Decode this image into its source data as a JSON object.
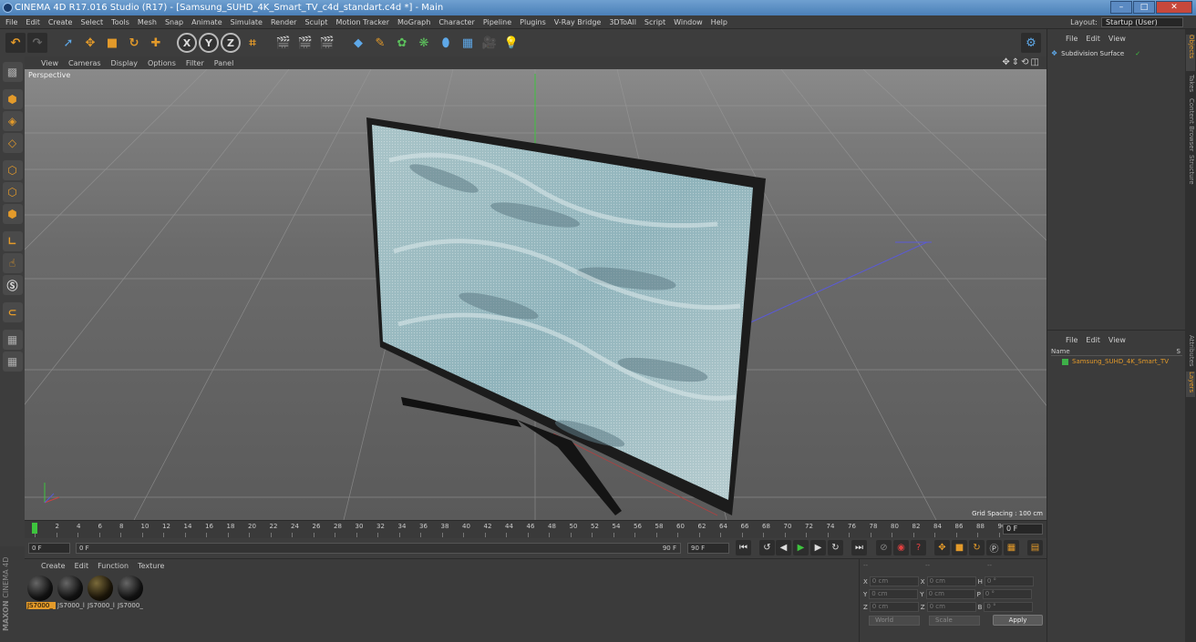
{
  "window": {
    "title": "CINEMA 4D R17.016 Studio (R17) - [Samsung_SUHD_4K_Smart_TV_c4d_standart.c4d *] - Main"
  },
  "menubar": {
    "items": [
      "File",
      "Edit",
      "Create",
      "Select",
      "Tools",
      "Mesh",
      "Snap",
      "Animate",
      "Simulate",
      "Render",
      "Sculpt",
      "Motion Tracker",
      "MoGraph",
      "Character",
      "Pipeline",
      "Plugins",
      "V-Ray Bridge",
      "3DToAll",
      "Script",
      "Window",
      "Help"
    ],
    "layout_label": "Layout:",
    "layout_value": "Startup (User)"
  },
  "toolbar": {
    "axis_x": "X",
    "axis_y": "Y",
    "axis_z": "Z"
  },
  "viewport": {
    "menu": [
      "View",
      "Cameras",
      "Display",
      "Options",
      "Filter",
      "Panel"
    ],
    "label": "Perspective",
    "grid_spacing": "Grid Spacing : 100 cm",
    "icons": "✥⇕⟲◫"
  },
  "timeline": {
    "ticks": [
      "0",
      "2",
      "4",
      "6",
      "8",
      "10",
      "12",
      "14",
      "16",
      "18",
      "20",
      "22",
      "24",
      "26",
      "28",
      "30",
      "32",
      "34",
      "36",
      "38",
      "40",
      "42",
      "44",
      "46",
      "48",
      "50",
      "52",
      "54",
      "56",
      "58",
      "60",
      "62",
      "64",
      "66",
      "68",
      "70",
      "72",
      "74",
      "76",
      "78",
      "80",
      "82",
      "84",
      "86",
      "88",
      "90"
    ],
    "current_frame": "0 F"
  },
  "playbar": {
    "start": "0 F",
    "slider_start": "0 F",
    "slider_end": "90 F",
    "end": "90 F"
  },
  "materials": {
    "menu": [
      "Create",
      "Edit",
      "Function",
      "Texture"
    ],
    "items": [
      "JS7000_",
      "JS7000_l",
      "JS7000_l",
      "JS7000_"
    ],
    "brand_a": "MAXON",
    "brand_b": "CINEMA 4D"
  },
  "coordinates": {
    "header_a": "--",
    "header_b": "--",
    "header_c": "--",
    "rows": [
      {
        "a": "X",
        "av": "0 cm",
        "b": "X",
        "bv": "0 cm",
        "c": "H",
        "cv": "0 °"
      },
      {
        "a": "Y",
        "av": "0 cm",
        "b": "Y",
        "bv": "0 cm",
        "c": "P",
        "cv": "0 °"
      },
      {
        "a": "Z",
        "av": "0 cm",
        "b": "Z",
        "bv": "0 cm",
        "c": "B",
        "cv": "0 °"
      }
    ],
    "mode": "World",
    "scale": "Scale",
    "apply": "Apply"
  },
  "objects": {
    "menu": [
      "File",
      "Edit",
      "View"
    ],
    "item": "Subdivision Surface"
  },
  "layers": {
    "menu": [
      "File",
      "Edit",
      "View"
    ],
    "col_name": "Name",
    "col_s": "S",
    "item": "Samsung_SUHD_4K_Smart_TV"
  },
  "sidetabs": [
    "Objects",
    "Takes",
    "Content Browser",
    "Structure",
    "Attributes",
    "Layers"
  ]
}
